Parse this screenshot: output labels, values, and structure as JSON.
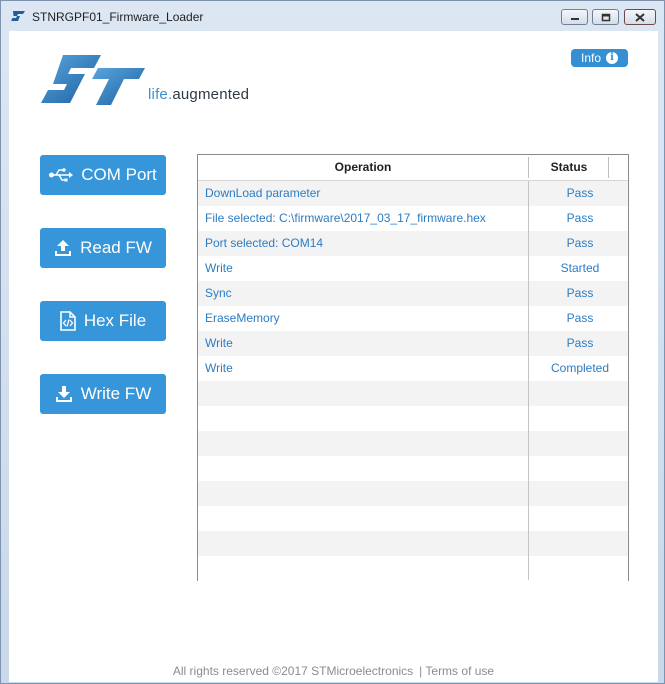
{
  "window": {
    "title": "STNRGPF01_Firmware_Loader"
  },
  "header": {
    "info_label": "Info",
    "tagline_part1": "life.",
    "tagline_part2": "augmented"
  },
  "sidebar": {
    "com_port_label": "COM Port",
    "read_fw_label": "Read FW",
    "hex_file_label": "Hex File",
    "write_fw_label": "Write FW"
  },
  "table": {
    "headers": {
      "operation": "Operation",
      "status": "Status"
    },
    "rows": [
      {
        "operation": "DownLoad parameter",
        "status": "Pass"
      },
      {
        "operation": "File selected: C:\\firmware\\2017_03_17_firmware.hex",
        "status": "Pass"
      },
      {
        "operation": "Port selected: COM14",
        "status": "Pass"
      },
      {
        "operation": "Write",
        "status": "Started"
      },
      {
        "operation": "Sync",
        "status": "Pass"
      },
      {
        "operation": "EraseMemory",
        "status": "Pass"
      },
      {
        "operation": "Write",
        "status": "Pass"
      },
      {
        "operation": "Write",
        "status": "Completed"
      },
      {
        "operation": "",
        "status": ""
      },
      {
        "operation": "",
        "status": ""
      },
      {
        "operation": "",
        "status": ""
      },
      {
        "operation": "",
        "status": ""
      },
      {
        "operation": "",
        "status": ""
      },
      {
        "operation": "",
        "status": ""
      },
      {
        "operation": "",
        "status": ""
      },
      {
        "operation": "",
        "status": ""
      }
    ]
  },
  "footer": {
    "copyright": "All rights reserved ©2017  STMicroelectronics",
    "terms": "| Terms of use"
  },
  "colors": {
    "accent": "#3796da",
    "link_text": "#2c7cc4",
    "logo_blue": "#1f6fb5"
  }
}
